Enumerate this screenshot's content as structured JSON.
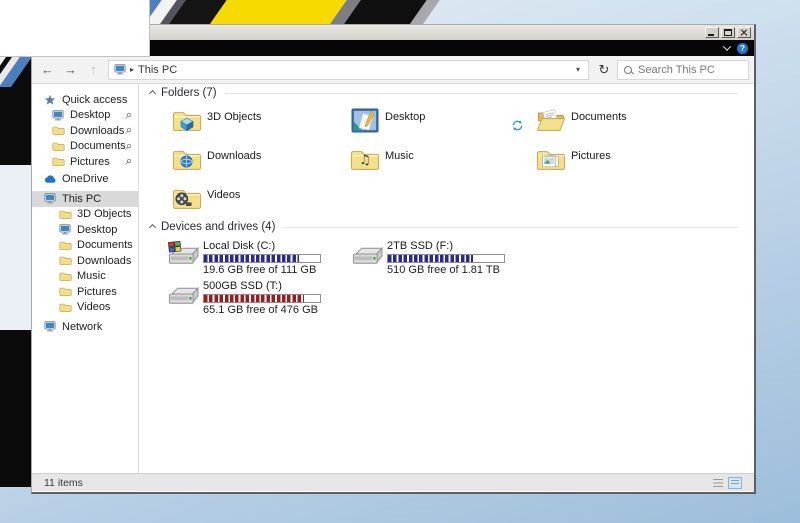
{
  "colors": {
    "drive_bar_blue": "#272a94",
    "drive_bar_red": "#9e1b1b",
    "sync_arrows_blue": "#1e9cd7",
    "help_badge_blue": "#2277d4",
    "sidebar_selection_gray": "#d9d9d9",
    "folder_yellow": "#f5e08a",
    "ribbon_black": "#050505"
  },
  "icons": {
    "back_arrow": "←",
    "forward_arrow": "→",
    "up_arrow": "↑",
    "refresh": "↻",
    "breadcrumb_arrow": "▸",
    "address_dropdown": "▾",
    "help": "?",
    "music_note": "♫"
  },
  "window": {
    "nav": {
      "address": "This PC",
      "search_placeholder": "Search This PC"
    },
    "sidebar": {
      "items": [
        {
          "label": "Quick access"
        },
        {
          "label": "Desktop",
          "pinned": true
        },
        {
          "label": "Downloads",
          "pinned": true
        },
        {
          "label": "Documents",
          "pinned": true
        },
        {
          "label": "Pictures",
          "pinned": true
        },
        {
          "label": "OneDrive"
        },
        {
          "label": "This PC",
          "selected": true
        },
        {
          "label": "3D Objects"
        },
        {
          "label": "Desktop"
        },
        {
          "label": "Documents"
        },
        {
          "label": "Downloads"
        },
        {
          "label": "Music"
        },
        {
          "label": "Pictures"
        },
        {
          "label": "Videos"
        },
        {
          "label": "Network"
        }
      ]
    },
    "groups": {
      "folders": {
        "title": "Folders (7)"
      },
      "devices": {
        "title": "Devices and drives (4)"
      }
    },
    "folders": [
      {
        "label": "3D Objects"
      },
      {
        "label": "Desktop"
      },
      {
        "label": "Documents"
      },
      {
        "label": "Downloads"
      },
      {
        "label": "Music"
      },
      {
        "label": "Pictures"
      },
      {
        "label": "Videos"
      }
    ],
    "drives": [
      {
        "name": "Local Disk (C:)",
        "free": "19.6 GB free of 111 GB",
        "percent": 82,
        "color": "#272a94"
      },
      {
        "name": "2TB SSD (F:)",
        "free": "510 GB free of 1.81 TB",
        "percent": 73,
        "color": "#272a94"
      },
      {
        "name": "500GB SSD (T:)",
        "free": "65.1 GB free of 476 GB",
        "percent": 86,
        "color": "#9e1b1b"
      }
    ],
    "status": {
      "items_text": "11 items"
    }
  }
}
